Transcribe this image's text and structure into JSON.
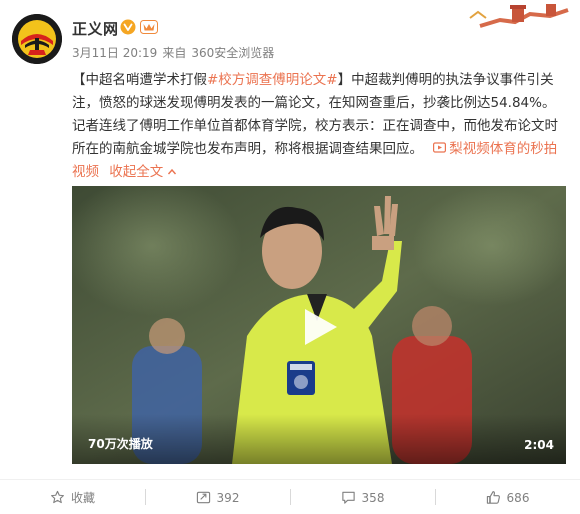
{
  "author": {
    "name": "正义网",
    "verified_icon": "verified-v-icon",
    "vip_icon": "vip-crown-icon"
  },
  "meta": {
    "date": "3月11日 20:19",
    "from_label": "来自",
    "source": "360安全浏览器"
  },
  "post": {
    "bracket_open": "【中超名哨遭学术打假",
    "hashtag": "#校方调查傅明论文#",
    "bracket_close": "】",
    "body": "中超裁判傅明的执法争议事件引关注，愤怒的球迷发现傅明发表的一篇论文，在知网查重后，抄袭比例达54.84%。记者连线了傅明工作单位首都体育学院，校方表示：正在调查中，而他发布论文时所在的南航金城学院也发布声明，称将根据调查结果回应。",
    "video_link": "梨视频体育的秒拍视频",
    "collapse": "收起全文"
  },
  "video": {
    "views": "70万次播放",
    "duration": "2:04"
  },
  "actions": {
    "favorite": "收藏",
    "repost": "392",
    "comment": "358",
    "like": "686"
  },
  "colors": {
    "accent": "#eb7350",
    "meta": "#808080",
    "text": "#333333"
  }
}
